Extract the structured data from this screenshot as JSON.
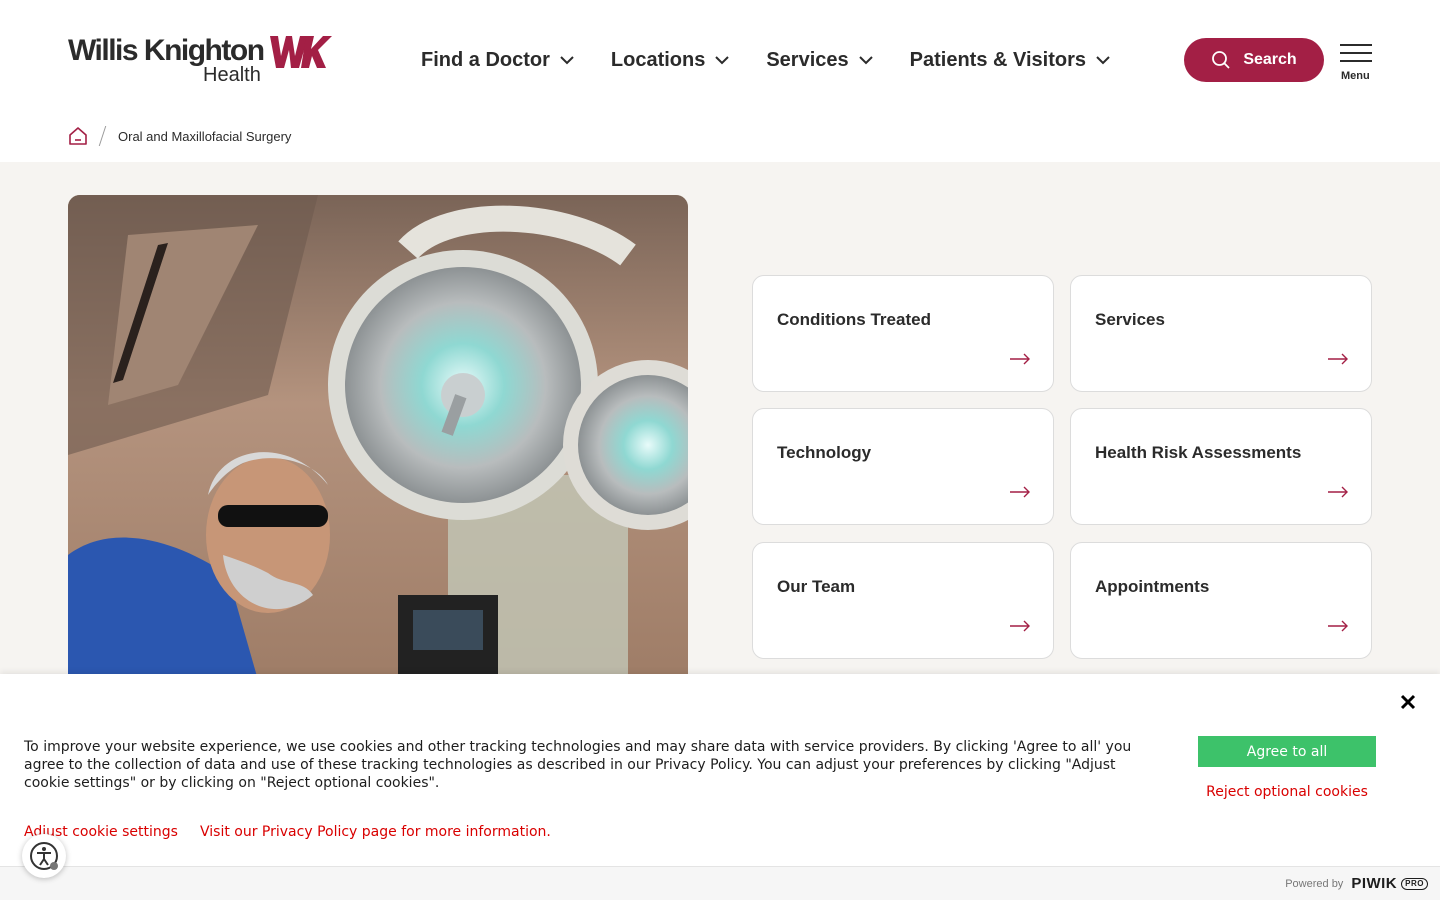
{
  "brand": {
    "name": "Willis Knighton",
    "sub": "Health",
    "accent_color": "#a31f45"
  },
  "nav": {
    "items": [
      {
        "label": "Find a Doctor"
      },
      {
        "label": "Locations"
      },
      {
        "label": "Services"
      },
      {
        "label": "Patients & Visitors"
      }
    ],
    "search_label": "Search",
    "menu_label": "Menu"
  },
  "breadcrumb": {
    "home_icon": "home-icon",
    "current": "Oral and Maxillofacial Surgery"
  },
  "cards": [
    {
      "title": "Conditions Treated"
    },
    {
      "title": "Services"
    },
    {
      "title": "Technology"
    },
    {
      "title": "Health Risk Assessments"
    },
    {
      "title": "Our Team"
    },
    {
      "title": "Appointments"
    }
  ],
  "cookie": {
    "text": "To improve your website experience, we use cookies and other tracking technologies and may share data with service providers. By clicking 'Agree to all' you agree to the collection of data and use of these tracking technologies as described in our Privacy Policy. You can adjust your preferences by clicking \"Adjust cookie settings\" or by clicking on \"Reject optional cookies\".",
    "adjust_label": "Adjust cookie settings",
    "privacy_label": "Visit our Privacy Policy page for more information.",
    "agree_label": "Agree to all",
    "reject_label": "Reject optional cookies",
    "agree_color": "#3dc26a",
    "link_color": "#d90000"
  },
  "footer": {
    "powered_by": "Powered by",
    "vendor": "PIWIK",
    "vendor_badge": "PRO"
  }
}
